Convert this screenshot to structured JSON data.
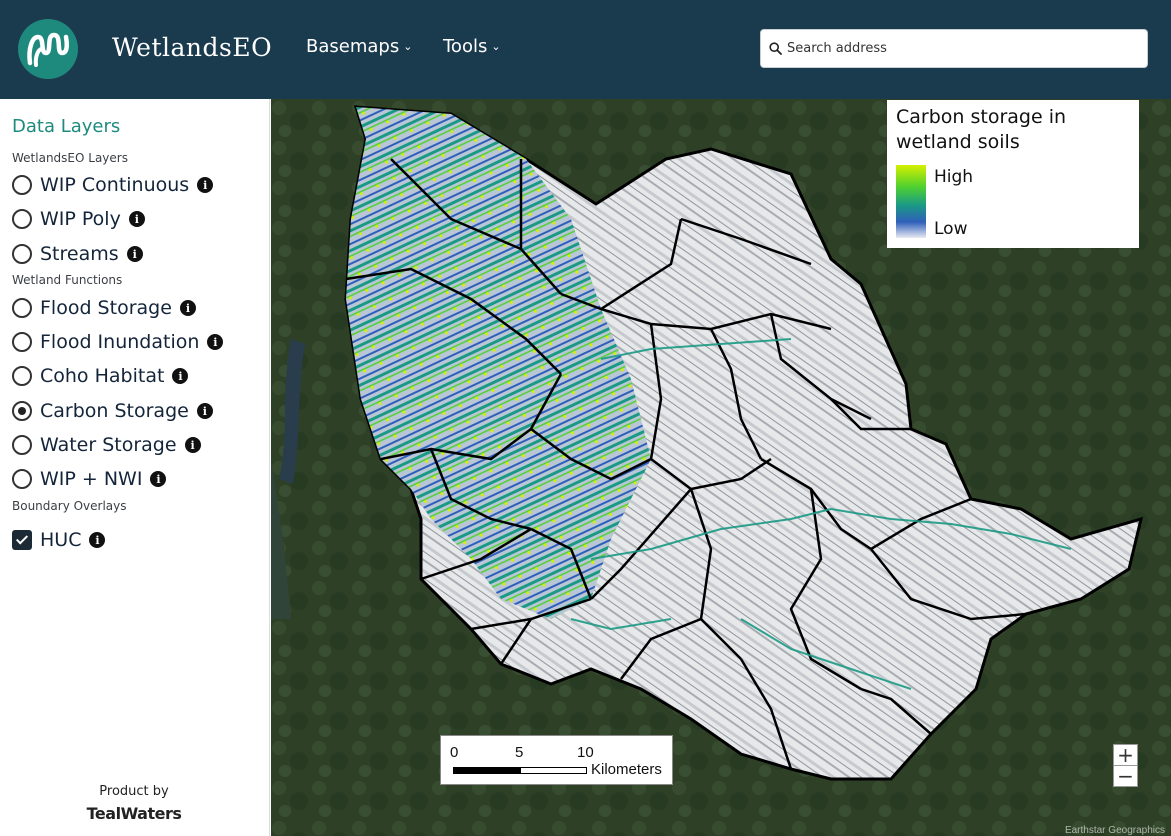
{
  "app": {
    "title": "WetlandsEO"
  },
  "header": {
    "logo": "wavy-stream-logo",
    "nav": [
      {
        "label": "Basemaps",
        "icon": "chevron-down-icon"
      },
      {
        "label": "Tools",
        "icon": "chevron-down-icon"
      }
    ],
    "search": {
      "placeholder": "Search address",
      "value": "",
      "icon": "search-icon"
    }
  },
  "sidebar": {
    "title": "Data Layers",
    "groups": [
      {
        "label": "WetlandsEO Layers",
        "items": [
          {
            "label": "WIP Continuous",
            "control": "radio",
            "selected": false
          },
          {
            "label": "WIP Poly",
            "control": "radio",
            "selected": false
          },
          {
            "label": "Streams",
            "control": "radio",
            "selected": false
          }
        ]
      },
      {
        "label": "Wetland Functions",
        "items": [
          {
            "label": "Flood Storage",
            "control": "radio",
            "selected": false
          },
          {
            "label": "Flood Inundation",
            "control": "radio",
            "selected": false
          },
          {
            "label": "Coho Habitat",
            "control": "radio",
            "selected": false
          },
          {
            "label": "Carbon Storage",
            "control": "radio",
            "selected": true
          },
          {
            "label": "Water Storage",
            "control": "radio",
            "selected": false
          },
          {
            "label": "WIP + NWI",
            "control": "radio",
            "selected": false
          }
        ]
      },
      {
        "label": "Boundary Overlays",
        "items": [
          {
            "label": "HUC",
            "control": "checkbox",
            "selected": true
          }
        ]
      }
    ],
    "info_icon_text": "i",
    "credit": {
      "line1": "Product by",
      "line2": "TealWaters"
    }
  },
  "map": {
    "legend": {
      "title": "Carbon storage in wetland soils",
      "high": "High",
      "low": "Low",
      "colors": [
        "#d5f000",
        "#4fd030",
        "#1a9a85",
        "#2f5fbb",
        "#e8eaf2"
      ]
    },
    "scale": {
      "ticks": [
        "0",
        "5",
        "10"
      ],
      "unit": "Kilometers"
    },
    "zoom": {
      "in": "+",
      "out": "−"
    },
    "attribution": "Earthstar Geographics"
  },
  "colors": {
    "header_bg": "#1a3a4e",
    "accent": "#1e8a7e",
    "text_dark": "#14253a"
  }
}
